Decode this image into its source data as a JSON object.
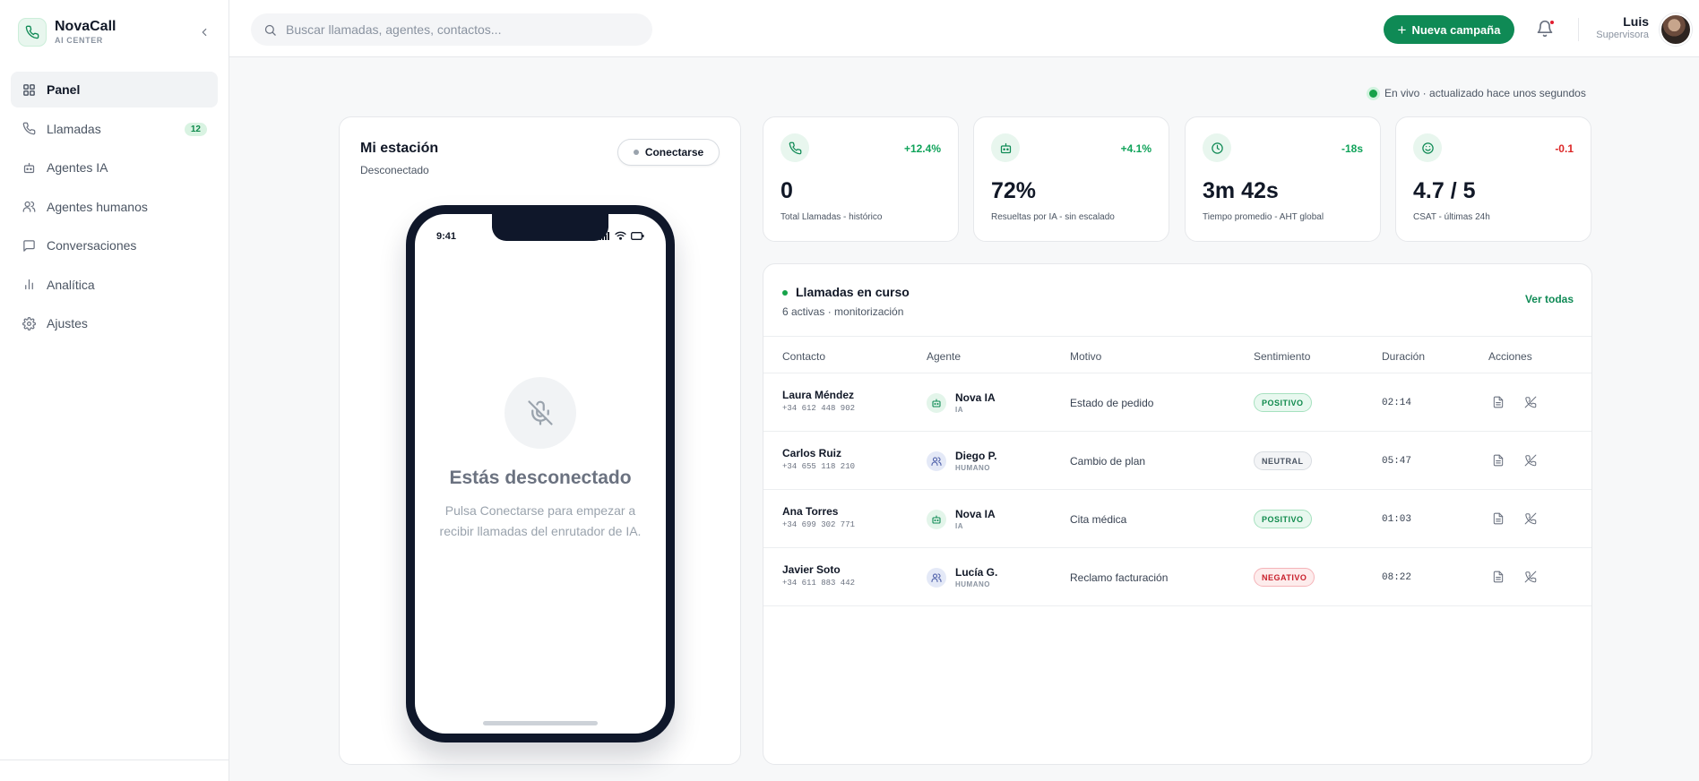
{
  "brand": {
    "name": "NovaCall",
    "subtitle": "AI CENTER"
  },
  "sidebar": {
    "items": [
      {
        "label": "Panel",
        "icon": "grid-icon",
        "active": true
      },
      {
        "label": "Llamadas",
        "icon": "phone-icon",
        "badge": "12"
      },
      {
        "label": "Agentes IA",
        "icon": "bot-icon"
      },
      {
        "label": "Agentes humanos",
        "icon": "users-icon"
      },
      {
        "label": "Conversaciones",
        "icon": "chat-icon"
      },
      {
        "label": "Analítica",
        "icon": "bar-chart-icon"
      },
      {
        "label": "Ajustes",
        "icon": "gear-icon"
      }
    ]
  },
  "topbar": {
    "search_placeholder": "Buscar llamadas, agentes, contactos...",
    "new_campaign_label": "Nueva campaña",
    "user_name": "Luis",
    "user_role": "Supervisora"
  },
  "live_status": "En vivo · actualizado hace unos segundos",
  "station": {
    "title": "Mi estación",
    "subtitle": "Desconectado",
    "connect_label": "Conectarse",
    "phone_time": "9:41",
    "disconnected_title": "Estás desconectado",
    "disconnected_text": "Pulsa Conectarse para empezar a recibir llamadas del enrutador de IA."
  },
  "kpis": [
    {
      "icon": "phone-icon",
      "delta": "+12.4%",
      "delta_color": "#10a35a",
      "value": "0",
      "label": "Total Llamadas - histórico"
    },
    {
      "icon": "bot-icon",
      "delta": "+4.1%",
      "delta_color": "#10a35a",
      "value": "72%",
      "label": "Resueltas por IA - sin escalado"
    },
    {
      "icon": "clock-icon",
      "delta": "-18s",
      "delta_color": "#10a35a",
      "value": "3m 42s",
      "label": "Tiempo promedio - AHT global"
    },
    {
      "icon": "smile-icon",
      "delta": "-0.1",
      "delta_color": "#dc2626",
      "value": "4.7 / 5",
      "label": "CSAT - últimas 24h"
    }
  ],
  "calls": {
    "title": "Llamadas en curso",
    "subtitle": "6 activas · monitorización",
    "see_all": "Ver todas",
    "columns": [
      "Contacto",
      "Agente",
      "Motivo",
      "Sentimiento",
      "Duración",
      "Acciones"
    ],
    "rows": [
      {
        "name": "Laura Méndez",
        "phone": "+34 612 448 902",
        "agent": "Nova IA",
        "agent_type": "IA",
        "motivo": "Estado de pedido",
        "sentiment": "POSITIVO",
        "duration": "02:14"
      },
      {
        "name": "Carlos Ruiz",
        "phone": "+34 655 118 210",
        "agent": "Diego P.",
        "agent_type": "HUMANO",
        "motivo": "Cambio de plan",
        "sentiment": "NEUTRAL",
        "duration": "05:47"
      },
      {
        "name": "Ana Torres",
        "phone": "+34 699 302 771",
        "agent": "Nova IA",
        "agent_type": "IA",
        "motivo": "Cita médica",
        "sentiment": "POSITIVO",
        "duration": "01:03"
      },
      {
        "name": "Javier Soto",
        "phone": "+34 611 883 442",
        "agent": "Lucía G.",
        "agent_type": "HUMANO",
        "motivo": "Reclamo facturación",
        "sentiment": "NEGATIVO",
        "duration": "08:22"
      }
    ]
  },
  "colors": {
    "accent": "#0f8a55",
    "live": "#16a34a",
    "danger": "#dc2626"
  }
}
